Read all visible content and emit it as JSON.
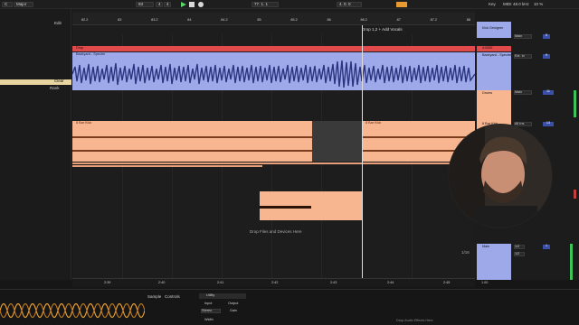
{
  "transport": {
    "key": "Major",
    "tempo": "93",
    "sig_num": "4",
    "sig_den": "4",
    "position": "77.  1.  1",
    "loop_len": "4.  0.  0",
    "key_label": "Key",
    "midi_label": "MIDI",
    "cpu": "48.0 kHz",
    "cpu_pct": "10 %"
  },
  "browser": {
    "edit_label": "Edit",
    "clear_label": "Clear",
    "rank_label": "Rank"
  },
  "ruler": {
    "bars": [
      "82.2",
      "83",
      "83.2",
      "84",
      "84.2",
      "85",
      "85.2",
      "86",
      "86.2",
      "87",
      "87.2",
      "88"
    ],
    "times": [
      "2:39",
      "2:40",
      "2:41",
      "2:42",
      "2:43",
      "2:44",
      "2:45"
    ]
  },
  "clips": {
    "red_label": "Drop",
    "blue_label": "Backyard - Spectre",
    "salmon_label": "8 Bar Kick",
    "salmon_label2": "8 Bar Kick",
    "locator": "Drop 1,2 + Add Vocals",
    "drop_hint": "Drop Files and Devices Here",
    "counter": "1/16"
  },
  "mixer": {
    "tracks": [
      {
        "name": "Kick Designer",
        "io": "Main",
        "num": "5"
      },
      {
        "name": "4-MIDI",
        "io": "",
        "num": ""
      },
      {
        "name": "Backyard - Spectre",
        "io": "Ext. In",
        "num": "9"
      },
      {
        "name": "Drums",
        "io": "Main",
        "num": "11"
      },
      {
        "name": "8 Bar Kick",
        "io": "All Ins",
        "num": "13"
      },
      {
        "name": "Main",
        "io": "1/2",
        "num": "1"
      }
    ],
    "main_out": "1/2",
    "zoom": "1.00"
  },
  "bottom": {
    "sample_tab": "Sample",
    "controls_tab": "Controls",
    "utility_label": "Utility",
    "input_label": "Input",
    "output_label": "Output",
    "stereo_label": "Stereo",
    "width_label": "Width",
    "gain_label": "Gain",
    "hint_text": "Drop Audio Effects Here"
  }
}
